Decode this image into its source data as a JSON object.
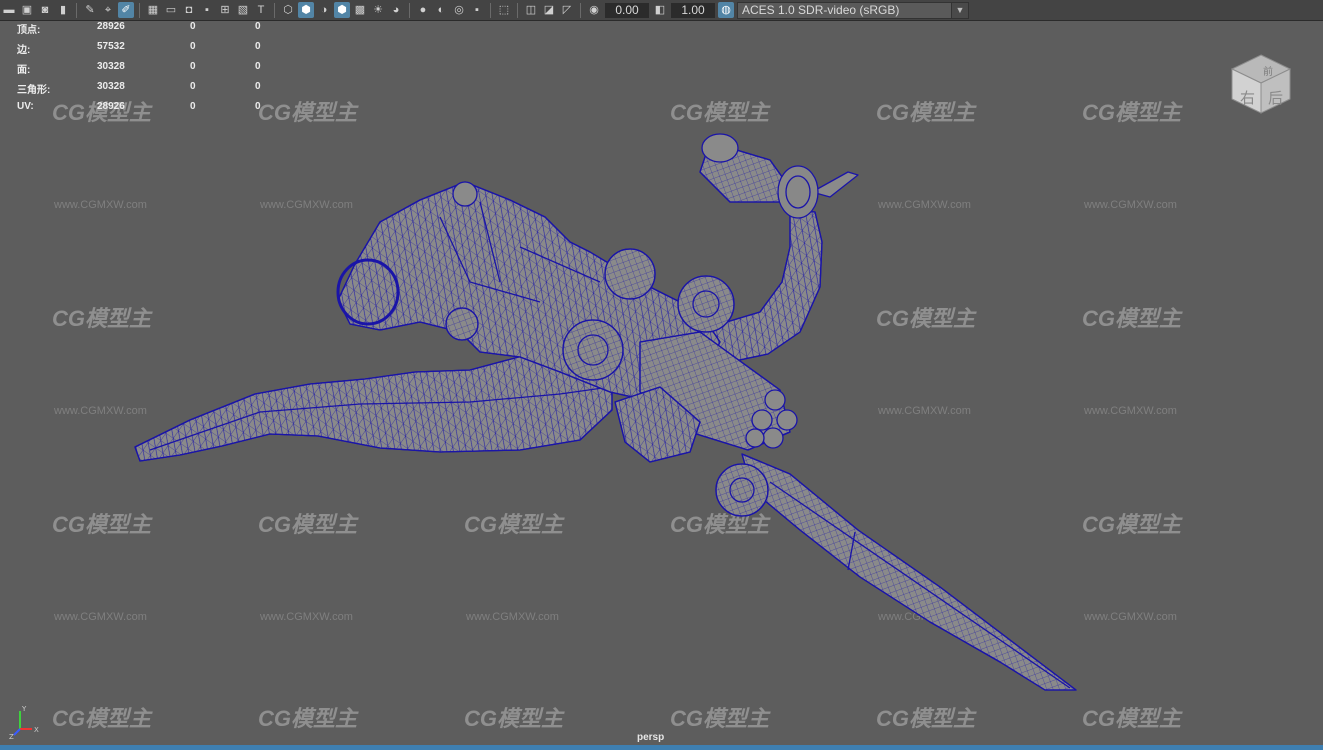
{
  "toolbar": {
    "exposure_value": "0.00",
    "gamma_value": "1.00",
    "colorspace_label": "ACES 1.0 SDR-video (sRGB)"
  },
  "hud": {
    "rows": [
      {
        "label": "顶点:",
        "value": "28926",
        "sel": "0",
        "uv": "0"
      },
      {
        "label": "边:",
        "value": "57532",
        "sel": "0",
        "uv": "0"
      },
      {
        "label": "面:",
        "value": "30328",
        "sel": "0",
        "uv": "0"
      },
      {
        "label": "三角形:",
        "value": "30328",
        "sel": "0",
        "uv": "0"
      },
      {
        "label": "UV:",
        "value": "28926",
        "sel": "0",
        "uv": "0"
      }
    ]
  },
  "viewport": {
    "camera_label": "persp",
    "viewcube_faces": [
      "前",
      "右",
      "后"
    ],
    "axis_labels": [
      "X",
      "Y",
      "Z"
    ],
    "watermark_logo": "CG模型主",
    "watermark_url": "www.CGMXW.com"
  },
  "colors": {
    "background": "#5d5d5d",
    "mesh_fill": "#8c8c8c",
    "wireframe": "#1a14a8",
    "toolbar": "#444444",
    "accent": "#5285a6",
    "status_bar": "#3e7fb1"
  }
}
